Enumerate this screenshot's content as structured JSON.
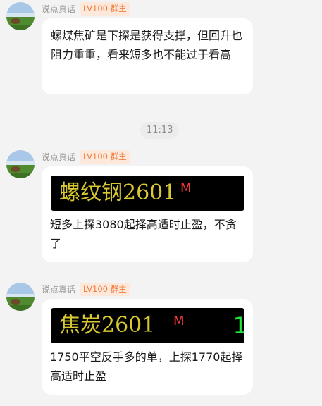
{
  "messages": [
    {
      "sender": "说点真话",
      "badge": "LV100 群主",
      "text": "螺煤焦矿是下探是获得支撑，但回升也阻力重重，看来短多也不能过于看高"
    },
    {
      "sender": "说点真话",
      "badge": "LV100 群主",
      "quote_name": "螺纹钢2601",
      "quote_flag": "M",
      "text": "短多上探3080起择高适时止盈，不贪了"
    },
    {
      "sender": "说点真话",
      "badge": "LV100 群主",
      "quote_name": "焦炭2601",
      "quote_flag": "M",
      "quote_extra": "1",
      "text": "1750平空反手多的单，上探1770起择高适时止盈"
    }
  ],
  "time_divider": "11:13",
  "colors": {
    "badge_text": "#f07a3a",
    "badge_bg": "#fde9dc",
    "quote_text": "#d8c832",
    "quote_flag": "#ff3a3a",
    "quote_extra": "#22e83a"
  },
  "icons": {
    "avatar": "landscape-avatar-icon"
  }
}
